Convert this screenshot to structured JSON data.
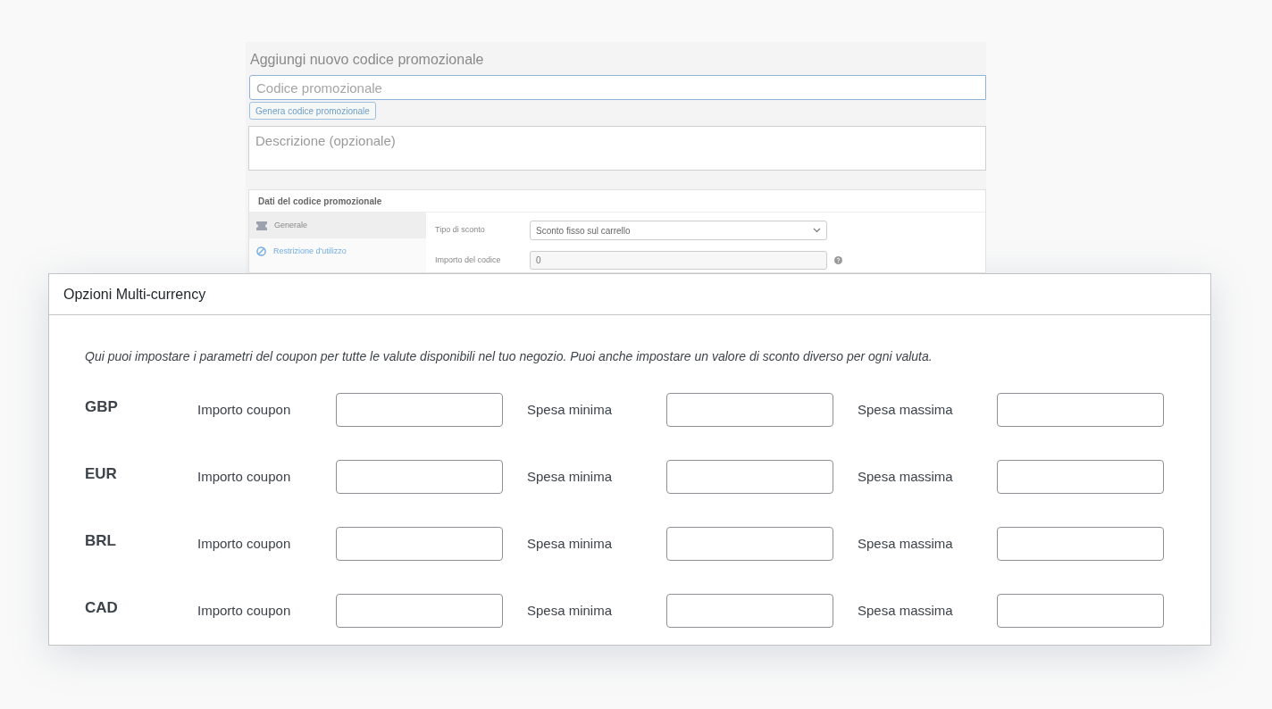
{
  "background_screen": {
    "title": "Aggiungi nuovo codice promozionale",
    "code_field": {
      "placeholder": "Codice promozionale"
    },
    "generate_button": "Genera codice promozionale",
    "description_field": {
      "placeholder": "Descrizione (opzionale)"
    },
    "data_box": {
      "title": "Dati del codice promozionale",
      "tabs": [
        {
          "label": "Generale",
          "selected": true,
          "kind": "ticket"
        },
        {
          "label": "Restrizione d'utilizzo",
          "selected": false,
          "kind": "ban"
        }
      ],
      "fields": [
        {
          "label": "Tipo di sconto",
          "kind": "select",
          "value": "Sconto fisso sul carrello"
        },
        {
          "label": "Importo del codice",
          "kind": "input",
          "value": "0"
        }
      ]
    }
  },
  "multi_currency": {
    "title": "Opzioni Multi-currency",
    "description": "Qui puoi impostare i parametri del coupon per tutte le valute disponibili nel tuo negozio. Puoi anche impostare un valore di sconto diverso per ogni valuta.",
    "rows": [
      {
        "currency": "GBP",
        "fields": [
          {
            "label": "Importo coupon"
          },
          {
            "label": "Spesa minima"
          },
          {
            "label": "Spesa massima"
          }
        ]
      },
      {
        "currency": "EUR",
        "fields": [
          {
            "label": "Importo coupon"
          },
          {
            "label": "Spesa minima"
          },
          {
            "label": "Spesa massima"
          }
        ]
      },
      {
        "currency": "BRL",
        "fields": [
          {
            "label": "Importo coupon"
          },
          {
            "label": "Spesa minima"
          },
          {
            "label": "Spesa massima"
          }
        ]
      },
      {
        "currency": "CAD",
        "fields": [
          {
            "label": "Importo coupon"
          },
          {
            "label": "Spesa minima"
          },
          {
            "label": "Spesa massima"
          }
        ]
      }
    ]
  }
}
